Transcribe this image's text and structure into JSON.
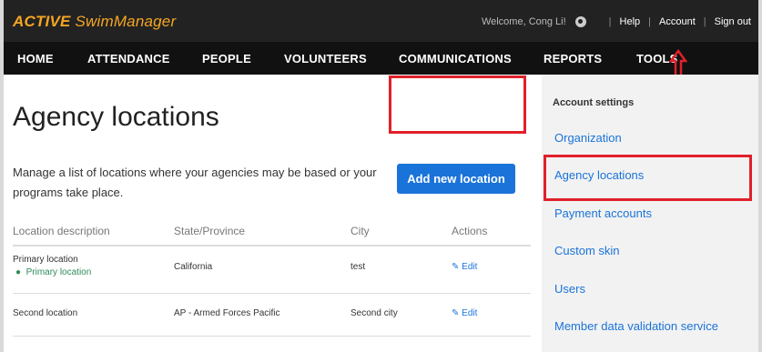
{
  "header": {
    "logo_strong": "ACTIVE",
    "logo_rest": " SwimManager",
    "welcome": "Welcome, Cong Li!",
    "links": [
      "Help",
      "Account",
      "Sign out"
    ]
  },
  "nav": [
    "HOME",
    "ATTENDANCE",
    "PEOPLE",
    "VOLUNTEERS",
    "COMMUNICATIONS",
    "REPORTS",
    "TOOLS"
  ],
  "page": {
    "title": "Agency locations",
    "description": "Manage a list of locations where your agencies may be based or your programs take place.",
    "add_button": "Add new location"
  },
  "table": {
    "headers": [
      "Location description",
      "State/Province",
      "City",
      "Actions"
    ],
    "rows": [
      {
        "description": "Primary location",
        "primary_label": "Primary location",
        "state": "California",
        "city": "test",
        "action": "Edit"
      },
      {
        "description": "Second location",
        "state": "AP - Armed Forces Pacific",
        "city": "Second city",
        "action": "Edit"
      }
    ]
  },
  "sidebar": {
    "title": "Account settings",
    "items": [
      "Organization",
      "Agency locations",
      "Payment accounts",
      "Custom skin",
      "Users",
      "Member data validation service"
    ]
  },
  "colors": {
    "accent": "#1a73d9",
    "highlight": "#e0202a",
    "logo": "#f5a623"
  }
}
